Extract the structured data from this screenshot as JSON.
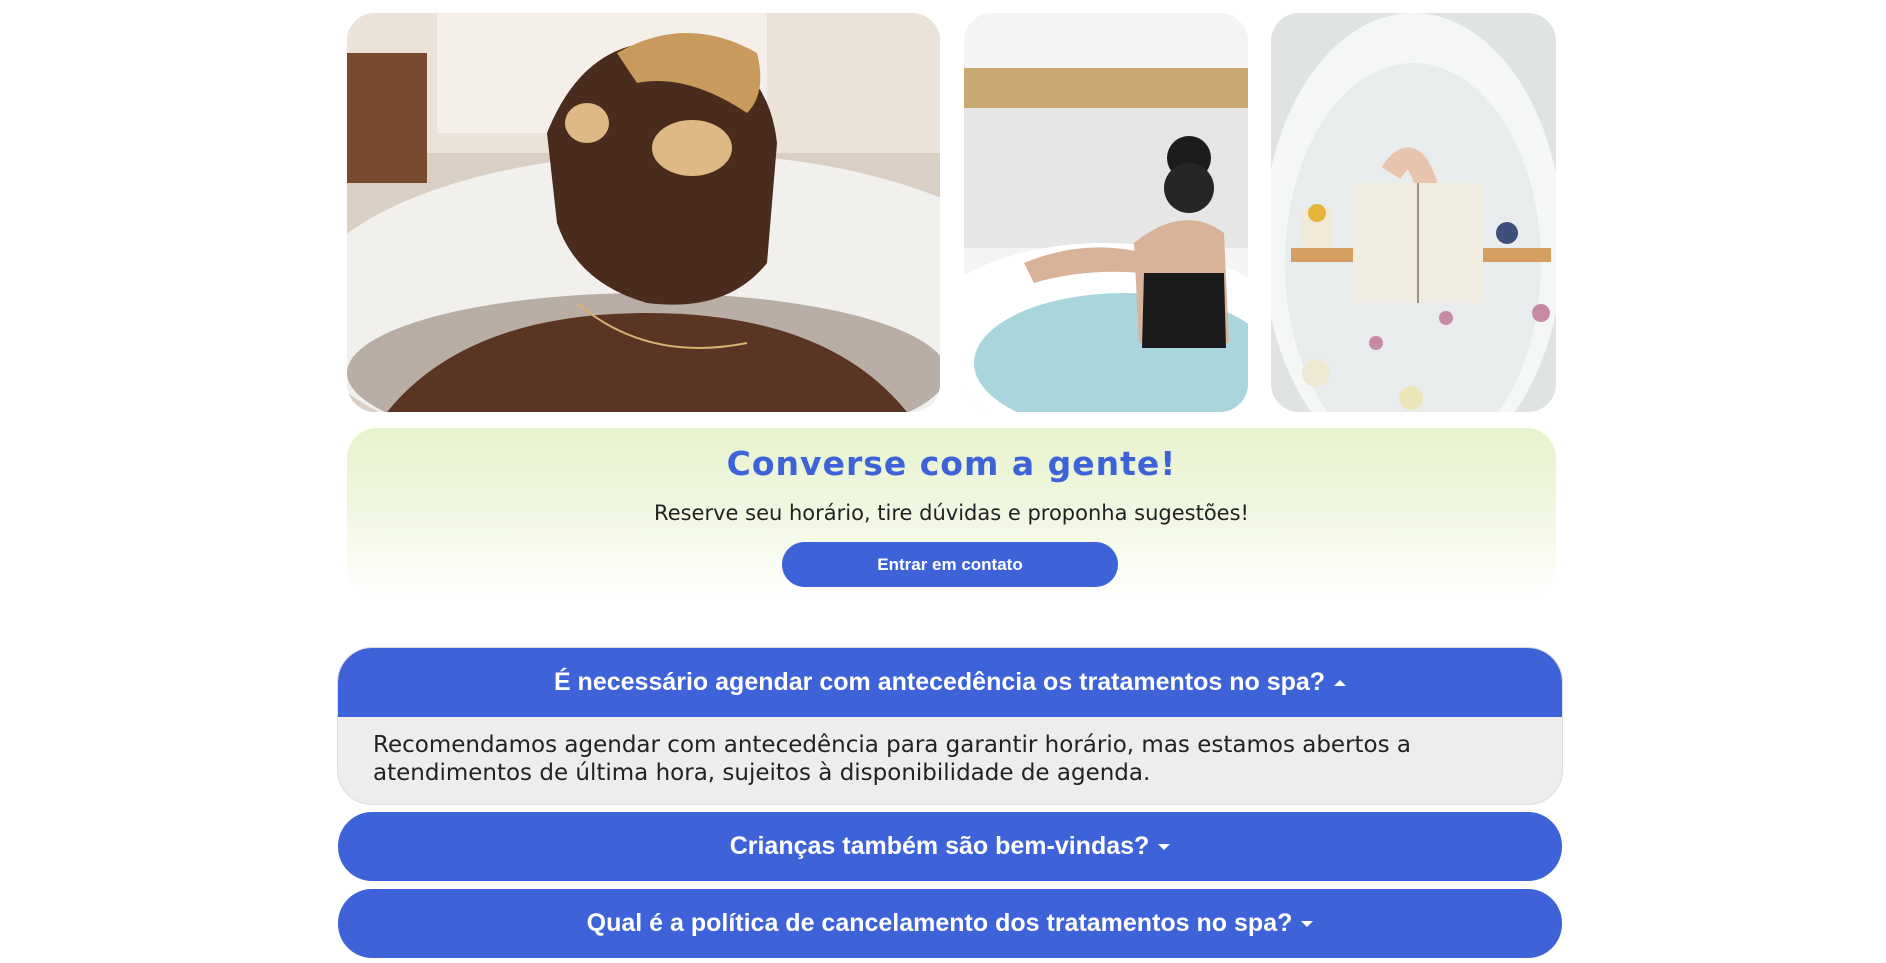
{
  "gallery": {
    "images": [
      {
        "icon": "photo-man-bath-eye-patches"
      },
      {
        "icon": "photo-woman-hot-tub-lake"
      },
      {
        "icon": "photo-bath-reading-book-flowers"
      }
    ]
  },
  "contact": {
    "title": "Converse com a gente!",
    "subtitle": "Reserve seu horário, tire dúvidas e proponha sugestões!",
    "button_label": "Entrar em contato"
  },
  "faq": {
    "items": [
      {
        "question": "É necessário agendar com antecedência os tratamentos no spa?",
        "answer": "Recomendamos agendar com antecedência para garantir horário, mas estamos abertos a atendimentos de última hora, sujeitos à disponibilidade de agenda.",
        "expanded": true
      },
      {
        "question": "Crianças também são bem-vindas?",
        "expanded": false
      },
      {
        "question": "Qual é a política de cancelamento dos tratamentos no spa?",
        "expanded": false
      }
    ]
  },
  "colors": {
    "accent": "#3e62d8",
    "contact_bg": "#e7f3cd",
    "answer_bg": "#ededed"
  }
}
